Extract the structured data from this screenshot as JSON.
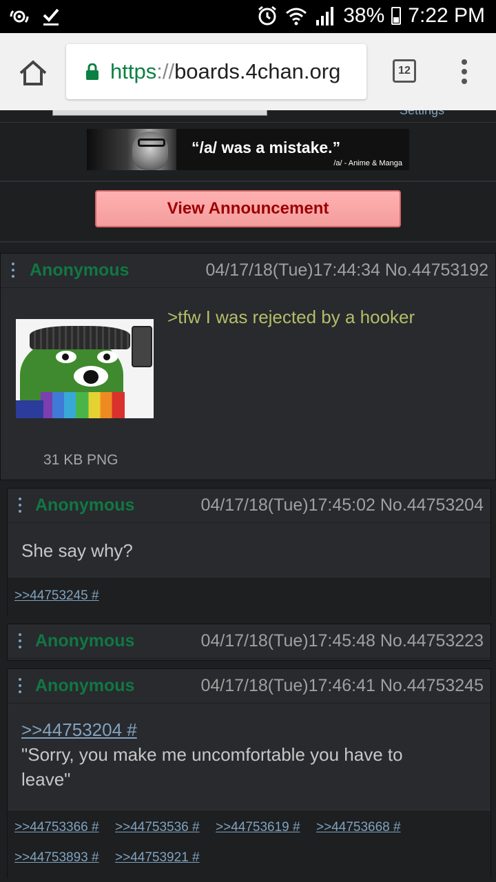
{
  "status_bar": {
    "battery": "38%",
    "time": "7:22 PM",
    "left_icons": [
      "sync-icon",
      "check-icon"
    ],
    "right_icons": [
      "alarm-icon",
      "wifi-icon",
      "signal-icon",
      "battery-icon"
    ]
  },
  "browser": {
    "url_scheme": "https",
    "url_sep": "://",
    "url_host": "boards.4chan.org",
    "tab_count": "12"
  },
  "page": {
    "banner": {
      "quote": "“/a/ was a mistake.”",
      "subtitle": "/a/ - Anime & Manga"
    },
    "announcement_label": "View Announcement",
    "top_strip_settings": "Settings"
  },
  "posts": [
    {
      "name": "Anonymous",
      "meta": "04/17/18(Tue)17:44:34 No.44753192",
      "text": ">tfw I was rejected by a hooker",
      "file": "31 KB PNG"
    },
    {
      "name": "Anonymous",
      "meta": "04/17/18(Tue)17:45:02 No.44753204",
      "text": "She say why?",
      "replies": [
        ">>44753245 #"
      ]
    },
    {
      "name": "Anonymous",
      "meta": "04/17/18(Tue)17:45:48 No.44753223"
    },
    {
      "name": "Anonymous",
      "meta": "04/17/18(Tue)17:46:41 No.44753245",
      "quote": ">>44753204 #",
      "text_line1": "\"Sorry, you make me uncomfortable you have to",
      "text_line2": "leave\"",
      "replies": [
        ">>44753366 #",
        ">>44753536 #",
        ">>44753619 #",
        ">>44753668 #",
        ">>44753893 #",
        ">>44753921 #"
      ]
    }
  ]
}
